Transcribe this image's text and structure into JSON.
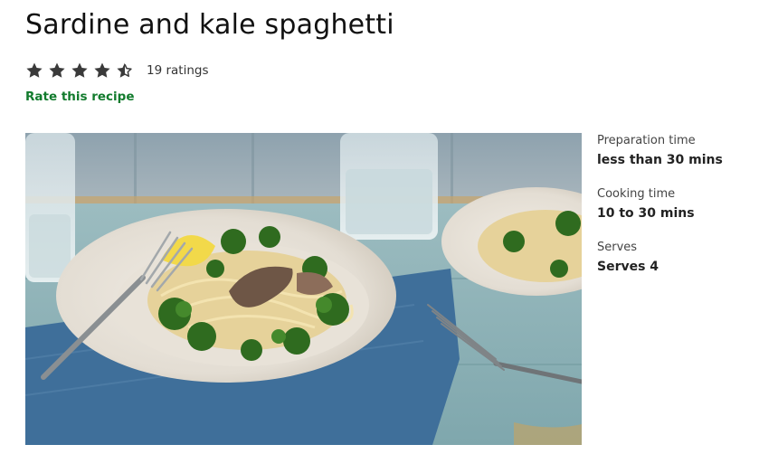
{
  "recipe": {
    "title": "Sardine and kale spaghetti",
    "rating": {
      "stars": 4.5,
      "max_stars": 5,
      "count_text": "19 ratings",
      "star_color": "#3a3a3a"
    },
    "rate_link": "Rate this recipe",
    "link_color": "#127b2d",
    "photo_icon": "recipe-photo",
    "info": [
      {
        "label": "Preparation time",
        "value": "less than 30 mins"
      },
      {
        "label": "Cooking time",
        "value": "10 to 30 mins"
      },
      {
        "label": "Serves",
        "value": "Serves 4"
      }
    ]
  }
}
